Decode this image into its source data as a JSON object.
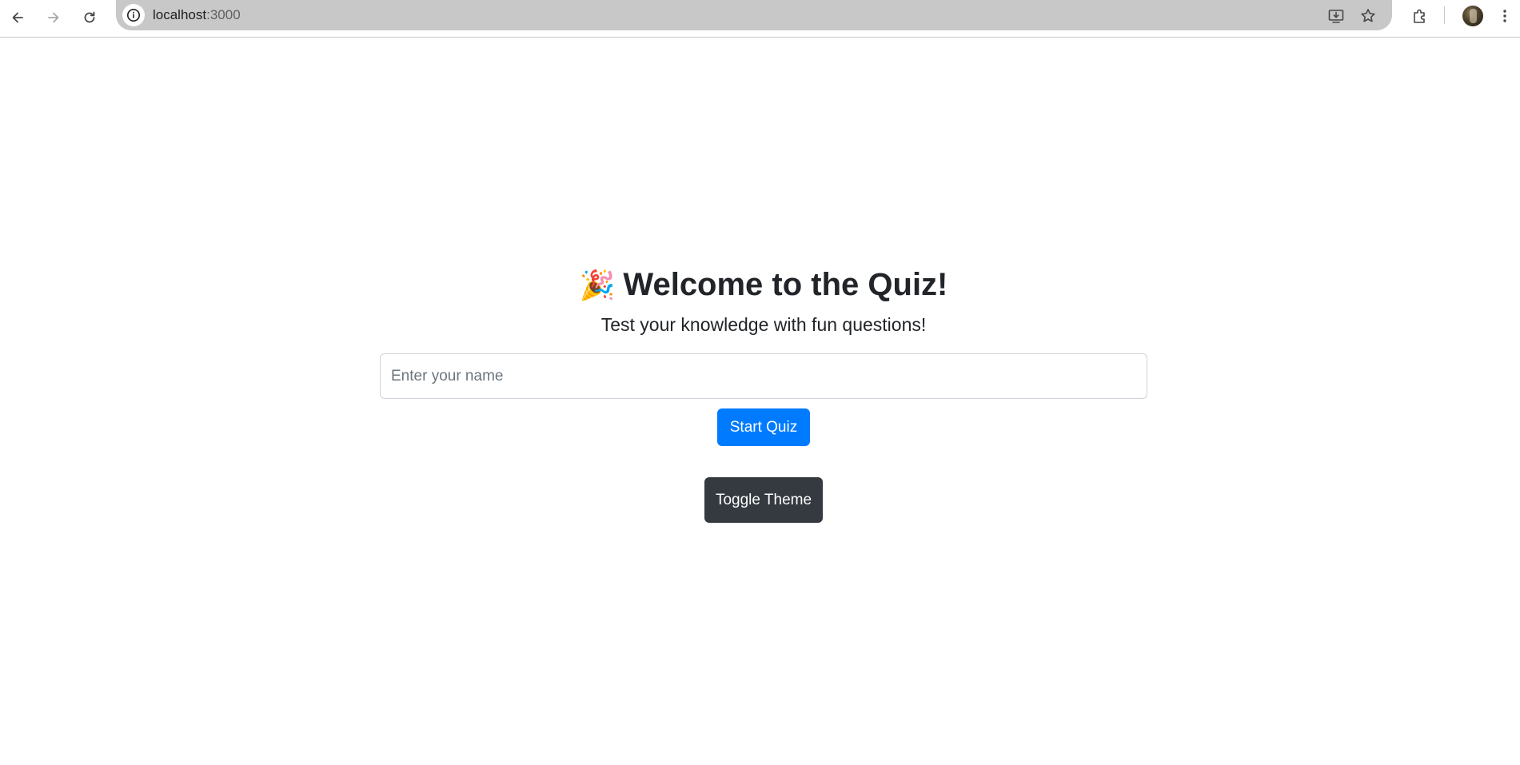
{
  "browser": {
    "url_host": "localhost",
    "url_port": ":3000"
  },
  "page": {
    "title_emoji": "🎉",
    "title": "Welcome to the Quiz!",
    "subtitle": "Test your knowledge with fun questions!",
    "name_input": {
      "placeholder": "Enter your name",
      "value": ""
    },
    "start_button_label": "Start Quiz",
    "theme_button_label": "Toggle Theme"
  },
  "colors": {
    "primary": "#007bff",
    "dark": "#343a40",
    "text": "#212529"
  },
  "icons": {
    "back": "arrow-left-icon",
    "forward": "arrow-right-icon",
    "reload": "reload-icon",
    "site_info": "info-icon",
    "install": "install-app-icon",
    "bookmark": "star-icon",
    "extensions": "puzzle-icon",
    "menu": "kebab-menu-icon"
  }
}
